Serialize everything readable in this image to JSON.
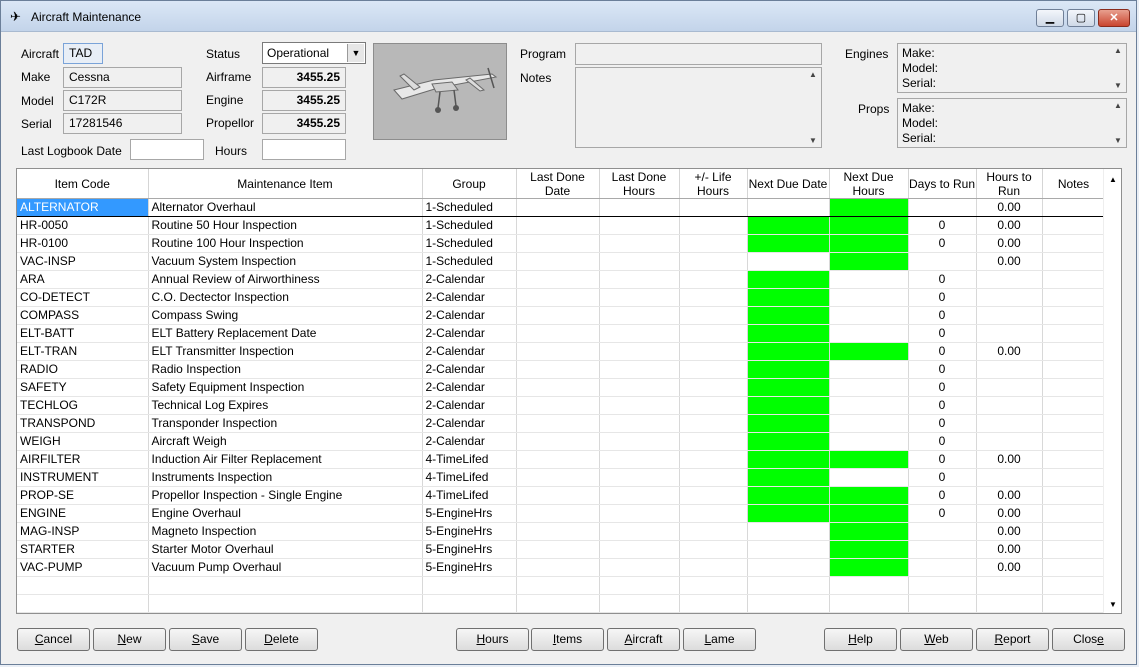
{
  "window": {
    "title": "Aircraft Maintenance",
    "min_label": "▁",
    "max_label": "▢",
    "close_label": "✕"
  },
  "aircraft": {
    "aircraft_label": "Aircraft",
    "aircraft_value": "TAD",
    "make_label": "Make",
    "make_value": "Cessna",
    "model_label": "Model",
    "model_value": "C172R",
    "serial_label": "Serial",
    "serial_value": "17281546",
    "logbook_label": "Last Logbook Date",
    "logbook_value": "",
    "status_label": "Status",
    "status_value": "Operational",
    "airframe_label": "Airframe",
    "airframe_value": "3455.25",
    "engine_label": "Engine",
    "engine_value": "3455.25",
    "propellor_label": "Propellor",
    "propellor_value": "3455.25",
    "hours_label": "Hours",
    "hours_value": ""
  },
  "program": {
    "label": "Program",
    "value": ""
  },
  "notes": {
    "label": "Notes",
    "value": ""
  },
  "engines": {
    "label": "Engines",
    "make": "Make:",
    "model": "Model:",
    "serial": "Serial:"
  },
  "props": {
    "label": "Props",
    "make": "Make:",
    "model": "Model:",
    "serial": "Serial:"
  },
  "grid": {
    "headers": [
      "Item Code",
      "Maintenance Item",
      "Group",
      "Last Done Date",
      "Last Done Hours",
      "+/- Life Hours",
      "Next Due Date",
      "Next Due Hours",
      "Days to Run",
      "Hours to Run",
      "Notes"
    ],
    "rows": [
      {
        "code": "ALTERNATOR",
        "item": "Alternator Overhaul",
        "group": "1-Scheduled",
        "due_date_green": false,
        "due_hours_green": true,
        "days": "",
        "hours": "0.00",
        "selected": true
      },
      {
        "code": "HR-0050",
        "item": "Routine 50 Hour Inspection",
        "group": "1-Scheduled",
        "due_date_green": true,
        "due_hours_green": true,
        "days": "0",
        "hours": "0.00"
      },
      {
        "code": "HR-0100",
        "item": "Routine 100 Hour Inspection",
        "group": "1-Scheduled",
        "due_date_green": true,
        "due_hours_green": true,
        "days": "0",
        "hours": "0.00"
      },
      {
        "code": "VAC-INSP",
        "item": "Vacuum System Inspection",
        "group": "1-Scheduled",
        "due_date_green": false,
        "due_hours_green": true,
        "days": "",
        "hours": "0.00"
      },
      {
        "code": "ARA",
        "item": "Annual Review of Airworthiness",
        "group": "2-Calendar",
        "due_date_green": true,
        "due_hours_green": false,
        "days": "0",
        "hours": ""
      },
      {
        "code": "CO-DETECT",
        "item": "C.O. Dectector Inspection",
        "group": "2-Calendar",
        "due_date_green": true,
        "due_hours_green": false,
        "days": "0",
        "hours": ""
      },
      {
        "code": "COMPASS",
        "item": "Compass Swing",
        "group": "2-Calendar",
        "due_date_green": true,
        "due_hours_green": false,
        "days": "0",
        "hours": ""
      },
      {
        "code": "ELT-BATT",
        "item": "ELT Battery Replacement Date",
        "group": "2-Calendar",
        "due_date_green": true,
        "due_hours_green": false,
        "days": "0",
        "hours": ""
      },
      {
        "code": "ELT-TRAN",
        "item": "ELT Transmitter Inspection",
        "group": "2-Calendar",
        "due_date_green": true,
        "due_hours_green": true,
        "days": "0",
        "hours": "0.00"
      },
      {
        "code": "RADIO",
        "item": "Radio Inspection",
        "group": "2-Calendar",
        "due_date_green": true,
        "due_hours_green": false,
        "days": "0",
        "hours": ""
      },
      {
        "code": "SAFETY",
        "item": "Safety Equipment Inspection",
        "group": "2-Calendar",
        "due_date_green": true,
        "due_hours_green": false,
        "days": "0",
        "hours": ""
      },
      {
        "code": "TECHLOG",
        "item": "Technical Log Expires",
        "group": "2-Calendar",
        "due_date_green": true,
        "due_hours_green": false,
        "days": "0",
        "hours": ""
      },
      {
        "code": "TRANSPOND",
        "item": "Transponder Inspection",
        "group": "2-Calendar",
        "due_date_green": true,
        "due_hours_green": false,
        "days": "0",
        "hours": ""
      },
      {
        "code": "WEIGH",
        "item": "Aircraft Weigh",
        "group": "2-Calendar",
        "due_date_green": true,
        "due_hours_green": false,
        "days": "0",
        "hours": ""
      },
      {
        "code": "AIRFILTER",
        "item": "Induction Air Filter Replacement",
        "group": "4-TimeLifed",
        "due_date_green": true,
        "due_hours_green": true,
        "days": "0",
        "hours": "0.00"
      },
      {
        "code": "INSTRUMENT",
        "item": "Instruments Inspection",
        "group": "4-TimeLifed",
        "due_date_green": true,
        "due_hours_green": false,
        "days": "0",
        "hours": ""
      },
      {
        "code": "PROP-SE",
        "item": "Propellor Inspection - Single Engine",
        "group": "4-TimeLifed",
        "due_date_green": true,
        "due_hours_green": true,
        "days": "0",
        "hours": "0.00"
      },
      {
        "code": "ENGINE",
        "item": "Engine Overhaul",
        "group": "5-EngineHrs",
        "due_date_green": true,
        "due_hours_green": true,
        "days": "0",
        "hours": "0.00"
      },
      {
        "code": "MAG-INSP",
        "item": "Magneto Inspection",
        "group": "5-EngineHrs",
        "due_date_green": false,
        "due_hours_green": true,
        "days": "",
        "hours": "0.00"
      },
      {
        "code": "STARTER",
        "item": "Starter Motor Overhaul",
        "group": "5-EngineHrs",
        "due_date_green": false,
        "due_hours_green": true,
        "days": "",
        "hours": "0.00"
      },
      {
        "code": "VAC-PUMP",
        "item": "Vacuum  Pump Overhaul",
        "group": "5-EngineHrs",
        "due_date_green": false,
        "due_hours_green": true,
        "days": "",
        "hours": "0.00"
      }
    ],
    "empty_rows": 2,
    "highlight_color": "#00ff00"
  },
  "buttons": {
    "cancel": {
      "u": "C",
      "rest": "ancel"
    },
    "new": {
      "u": "N",
      "rest": "ew"
    },
    "save": {
      "u": "S",
      "rest": "ave"
    },
    "delete": {
      "u": "D",
      "rest": "elete"
    },
    "hours": {
      "pre": "",
      "u": "H",
      "rest": "ours"
    },
    "items": {
      "pre": "",
      "u": "I",
      "rest": "tems"
    },
    "aircraft": {
      "pre": "",
      "u": "A",
      "rest": "ircraft"
    },
    "lame": {
      "pre": "",
      "u": "L",
      "rest": "ame"
    },
    "help": {
      "pre": "",
      "u": "H",
      "rest": "elp"
    },
    "web": {
      "pre": "",
      "u": "W",
      "rest": "eb"
    },
    "report": {
      "pre": "",
      "u": "R",
      "rest": "eport"
    },
    "close": {
      "pre": "Clos",
      "u": "e",
      "rest": ""
    }
  }
}
